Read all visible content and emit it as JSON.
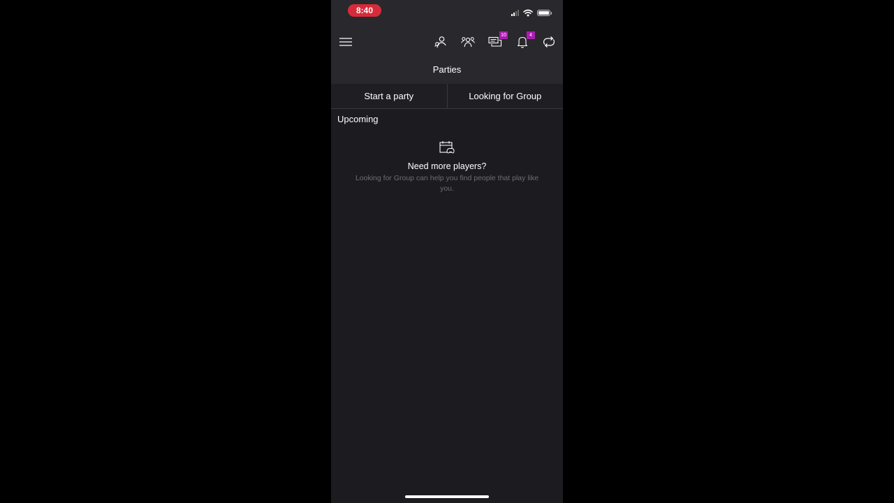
{
  "status_bar": {
    "time": "8:40"
  },
  "header": {
    "title": "Parties",
    "badges": {
      "chat": "10",
      "notifications": "4"
    }
  },
  "tabs": [
    {
      "label": "Start a party"
    },
    {
      "label": "Looking for Group"
    }
  ],
  "section": {
    "label": "Upcoming"
  },
  "empty_state": {
    "icon": "calendar-controller-icon",
    "heading": "Need more players?",
    "body": "Looking for Group can help you find people that play like you."
  },
  "colors": {
    "background": "#1c1b1f",
    "header": "#29282c",
    "badge": "#a81fb0",
    "status_time": "#d62b3a",
    "muted_text": "#6e6d72"
  }
}
